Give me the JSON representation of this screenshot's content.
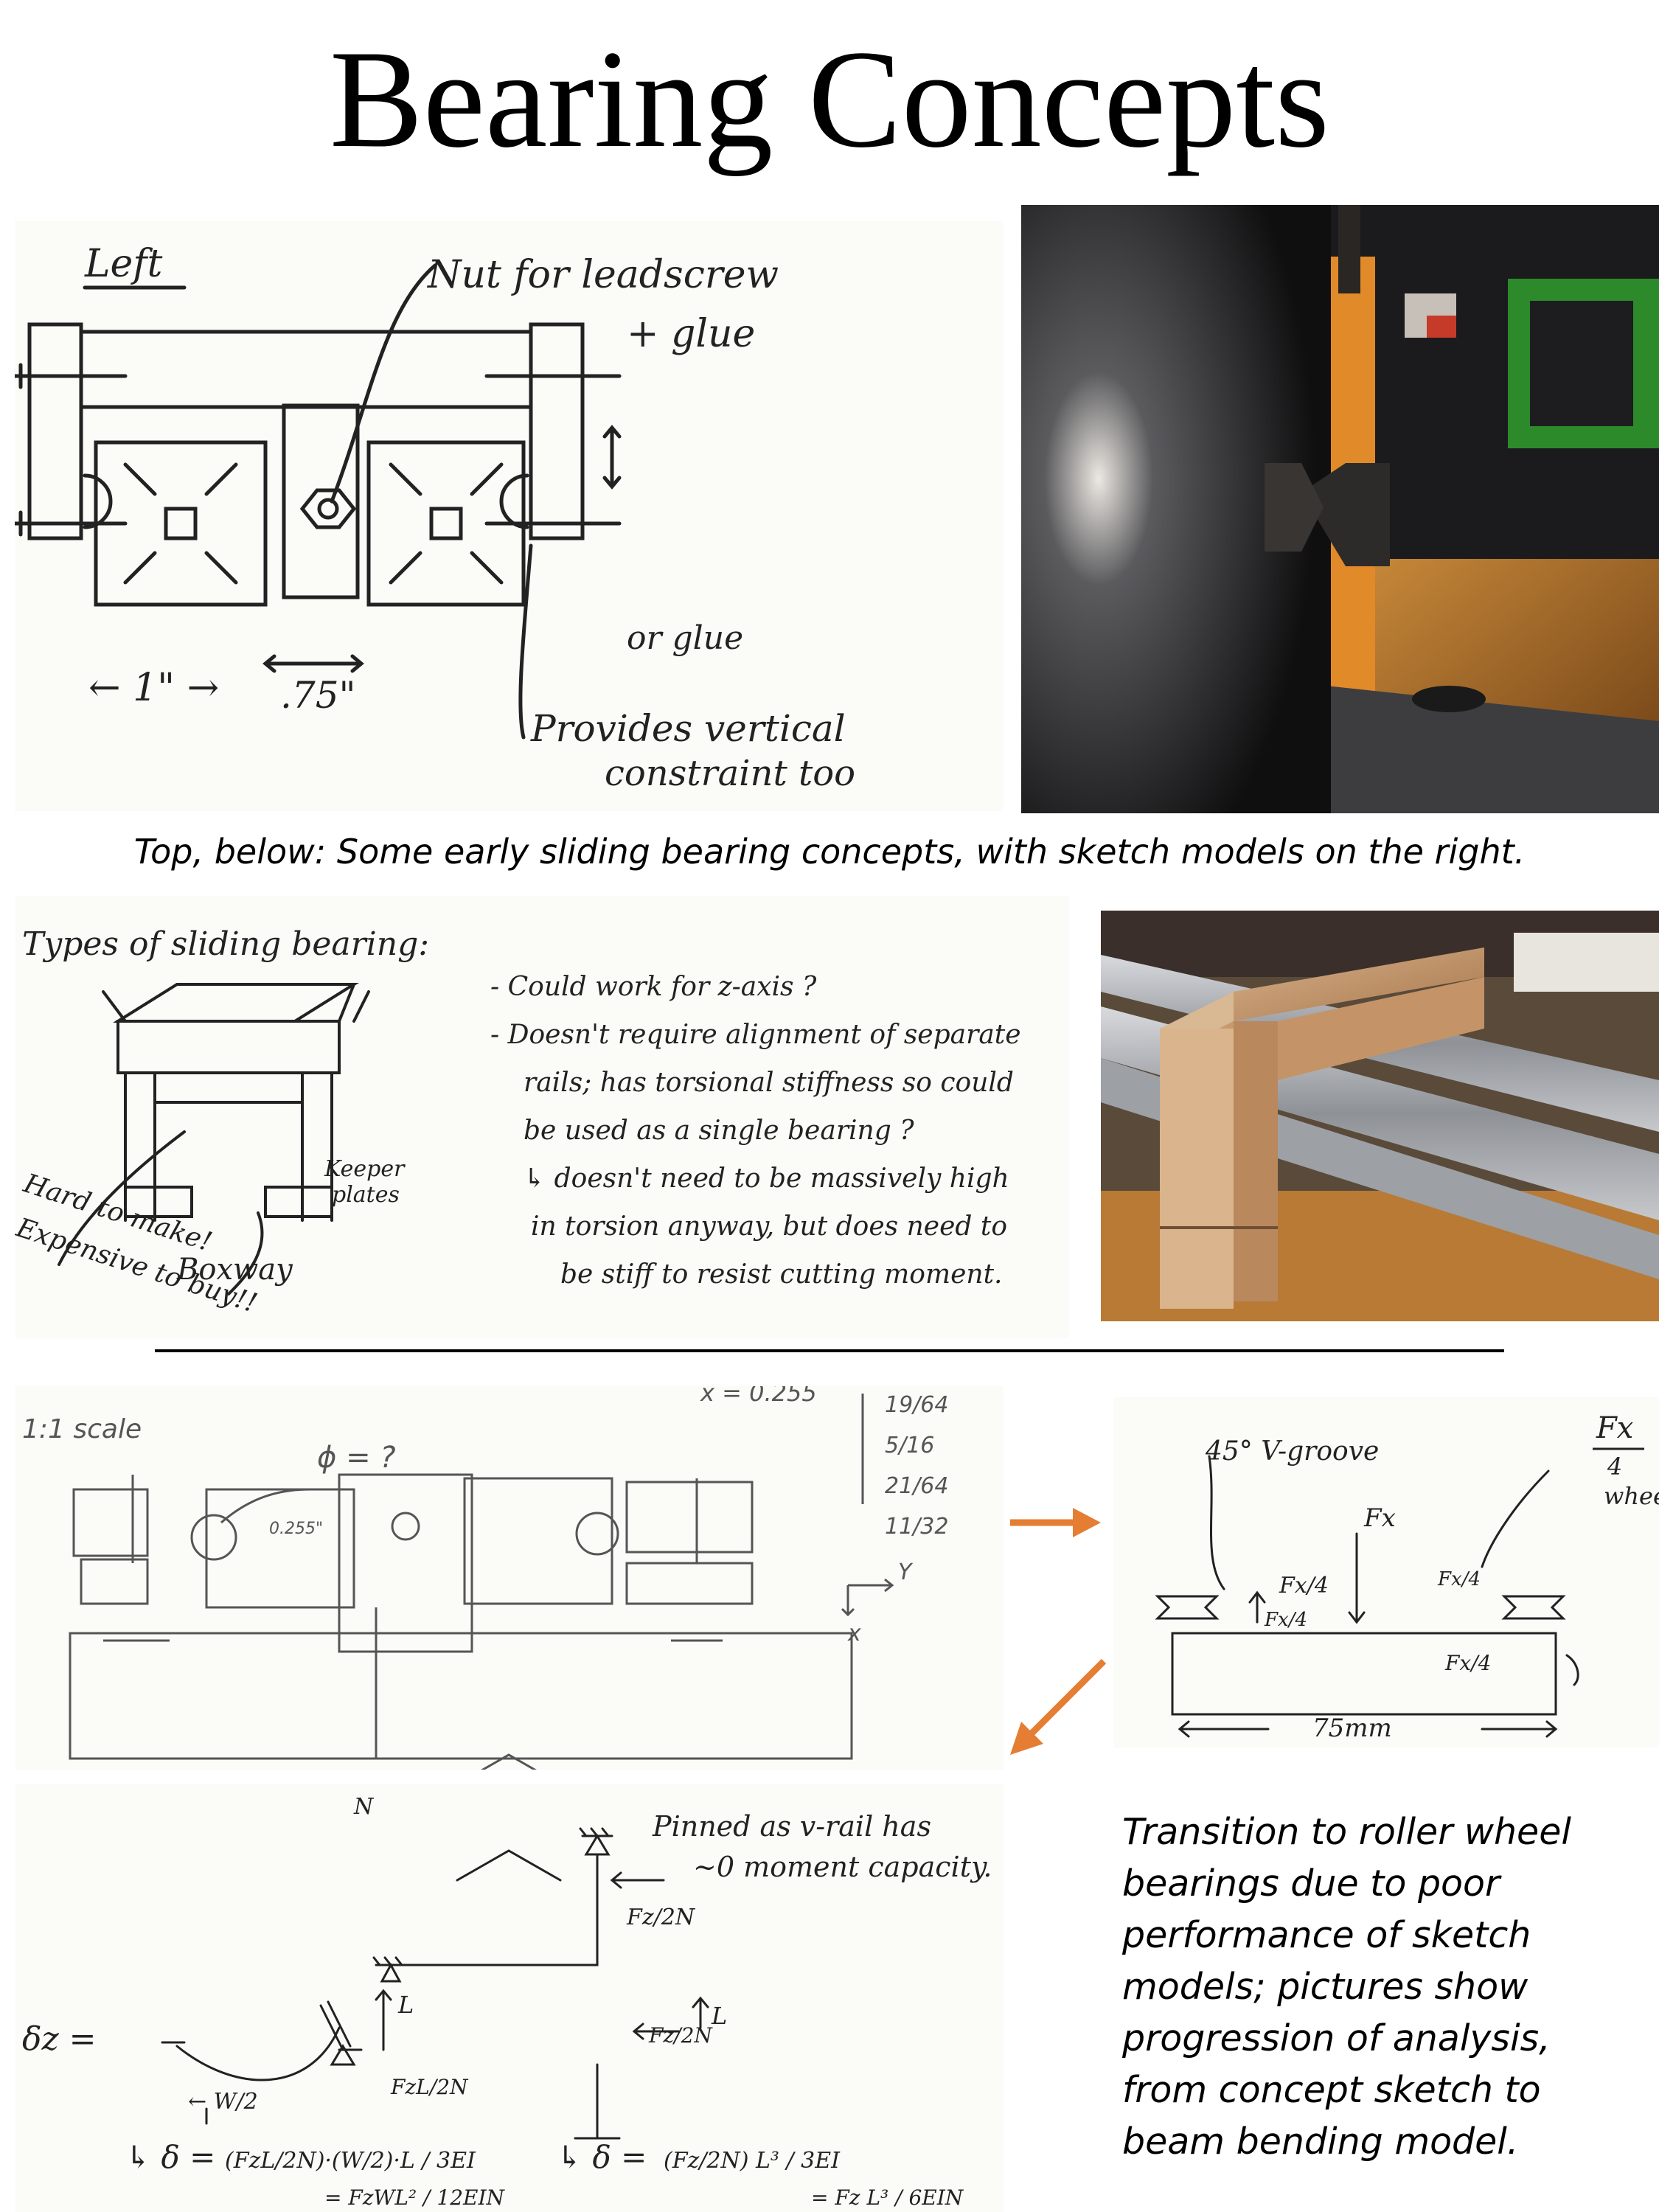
{
  "title": "Bearing Concepts",
  "caption_top": "Top, below: Some early sliding bearing concepts, with sketch models on the right.",
  "caption_side": "Transition to roller wheel bearings due to poor performance of sketch models; pictures show progression of analysis, from concept sketch to beam bending model.",
  "colors": {
    "arrow": "#e57d32",
    "ink": "#222222",
    "pencil": "#666666"
  },
  "sketch1": {
    "label_left": "Left",
    "note_nut": "Nut for leadscrew",
    "note_glue": "+ glue",
    "note_orglue": "or glue",
    "note_provides": "Provides vertical",
    "note_constraint": "constraint too",
    "dim_1in": "← 1\" →",
    "dim_75": ".75\""
  },
  "sketch2": {
    "heading": "Types of sliding bearing:",
    "label_boxway": "Boxway",
    "label_keeper": "Keeper",
    "label_plates": "plates",
    "note_hard1": "Hard to make!",
    "note_hard2": "Expensive to buy!!",
    "notes": [
      "- Could work for z-axis ?",
      "- Doesn't require alignment of separate",
      "rails; has torsional stiffness so could",
      "be used as a single bearing ?",
      "↳ doesn't need to be massively high",
      "in torsion anyway, but does need to",
      "be stiff to resist cutting moment."
    ]
  },
  "sketch3": {
    "scale": "1:1 scale",
    "phi": "ϕ = ?",
    "dim": "0.255\"",
    "x_eq": "x = 0.255",
    "fractions": [
      "19/64",
      "5/16",
      "21/64",
      "11/32"
    ],
    "axis_y": "Y",
    "axis_x": "x"
  },
  "sketch4": {
    "vgroove": "45° V-groove",
    "fx": "Fx",
    "fx4a": "Fx/4",
    "fx4b": "Fx/4",
    "fx4c": "Fx/4",
    "fx4d": "Fx/4",
    "dim": "75mm",
    "side_top": "Fx",
    "side_bot": "4",
    "side_word": "whee"
  },
  "sketch5": {
    "pinned1": "Pinned as v-rail has",
    "pinned2": "~0 moment capacity.",
    "fz2n": "Fz/2N",
    "delta_z": "δz =",
    "w2": "← W/2",
    "L": "L",
    "fzl2n": "FzL/2N",
    "eq1_lhs": "↳ δ =",
    "eq1_mid": "(FzL/2N)·(W/2)·L / 3EI",
    "eq1_rhs": "= FzWL² / 12EIN",
    "eq2_lhs": "↳ δ =",
    "eq2_mid": "(Fz/2N) L³ / 3EI",
    "eq2_rhs": "= Fz L³ / 6EIN",
    "N": "N"
  }
}
